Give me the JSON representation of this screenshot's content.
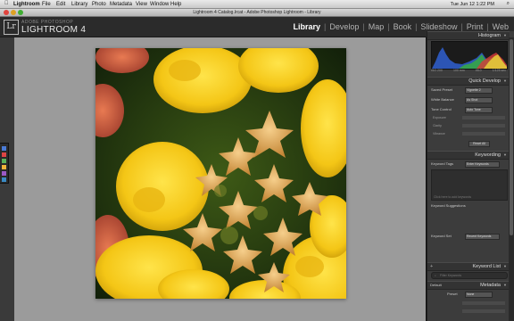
{
  "os_menubar": {
    "apple": "",
    "items": [
      "Lightroom",
      "File",
      "Edit",
      "Library",
      "Photo",
      "Metadata",
      "View",
      "Window",
      "Help"
    ],
    "clock": "Tue Jun 12  1:22 PM",
    "spotlight": "⌕"
  },
  "window": {
    "title": "Lightroom 4 Catalog.lrcat - Adobe Photoshop Lightroom - Library"
  },
  "header": {
    "logo": "Lr",
    "brand_small": "ADOBE PHOTOSHOP",
    "brand": "LIGHTROOM 4",
    "modules": [
      "Library",
      "Develop",
      "Map",
      "Book",
      "Slideshow",
      "Print",
      "Web"
    ],
    "active_module": "Library"
  },
  "histogram": {
    "title": "Histogram",
    "info": [
      "ISO 200",
      "100 mm",
      "f/8.0",
      "1/125 sec"
    ]
  },
  "quick_develop": {
    "title": "Quick Develop",
    "saved_preset_label": "Saved Preset",
    "saved_preset_value": "Vignette 2",
    "white_balance_label": "White Balance",
    "white_balance_value": "As Shot",
    "tone_control_label": "Tone Control",
    "tone_control_value": "Auto Tone",
    "exposure_label": "Exposure",
    "clarity_label": "Clarity",
    "vibrance_label": "Vibrance",
    "reset_label": "Reset All"
  },
  "keywording": {
    "title": "Keywording",
    "tags_label": "Keyword Tags",
    "tags_value": "Enter Keywords",
    "add_placeholder": "Click here to add keywords",
    "suggestions_label": "Keyword Suggestions",
    "set_label": "Keyword Set",
    "set_value": "Recent Keywords"
  },
  "keyword_list": {
    "title": "Keyword List",
    "filter_placeholder": "Filter Keywords"
  },
  "metadata": {
    "title": "Metadata",
    "preset_dropdown": "Default",
    "preset_label": "Preset",
    "preset_value": "None"
  },
  "colors": {
    "accent": "#ffffff",
    "panel_bg": "#3c3c3c",
    "workarea_bg": "#9b9b9b"
  }
}
